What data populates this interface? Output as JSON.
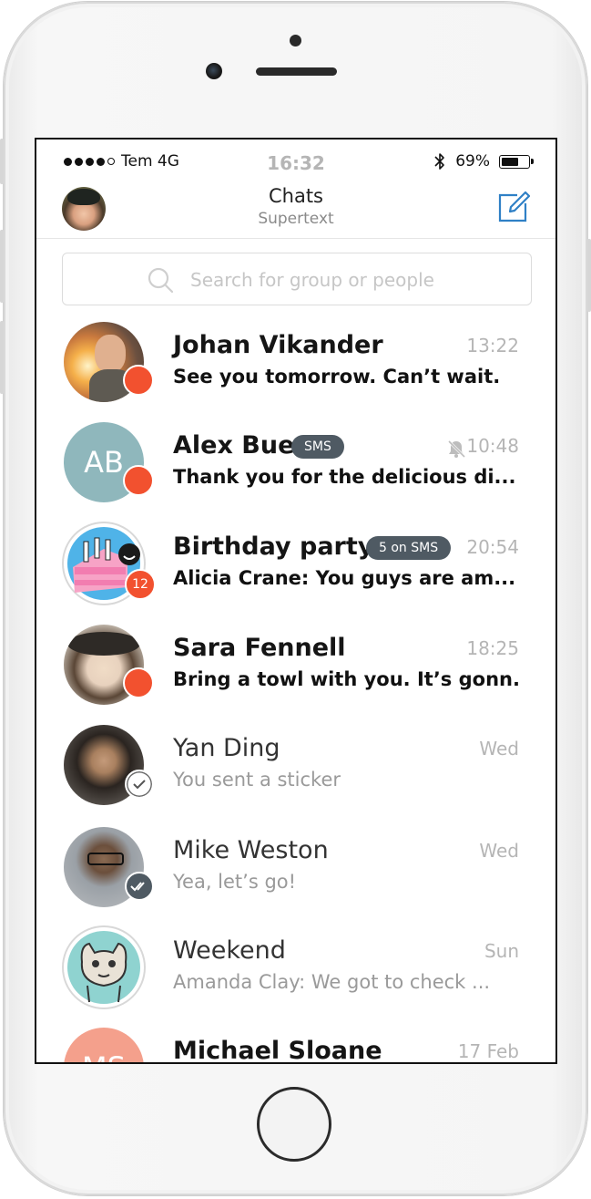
{
  "status_bar": {
    "carrier": "Tem 4G",
    "time": "16:32",
    "battery": "69%",
    "battery_level": 0.69
  },
  "header": {
    "title": "Chats",
    "subtitle": "Supertext"
  },
  "search": {
    "placeholder": "Search for group or people"
  },
  "chats": [
    {
      "name": "Johan Vikander",
      "message": "See you tomorrow. Can’t wait.",
      "time": "13:22",
      "unread": true
    },
    {
      "name": "Alex Bue",
      "initials": "AB",
      "tag": "SMS",
      "muted": true,
      "message": "Thank you for the delicious di...",
      "time": "10:48",
      "unread": true
    },
    {
      "name": "Birthday party",
      "tag": "5 on SMS",
      "message": "Alicia Crane: You guys are am...",
      "time": "20:54",
      "unread_count": "12"
    },
    {
      "name": "Sara Fennell",
      "message": "Bring a towl with you. It’s gonn...",
      "time": "18:25",
      "unread": true
    },
    {
      "name": "Yan Ding",
      "message": "You sent a sticker",
      "time": "Wed",
      "status": "sent"
    },
    {
      "name": "Mike Weston",
      "message": "Yea, let’s go!",
      "time": "Wed",
      "status": "read"
    },
    {
      "name": "Weekend",
      "message": "Amanda Clay: We got to check ...",
      "time": "Sun"
    },
    {
      "name": "Michael Sloane",
      "initials": "MS",
      "time": "17 Feb"
    }
  ],
  "colors": {
    "accent": "#2f80c6",
    "badge": "#f2512f",
    "tag": "#4f5a63"
  }
}
